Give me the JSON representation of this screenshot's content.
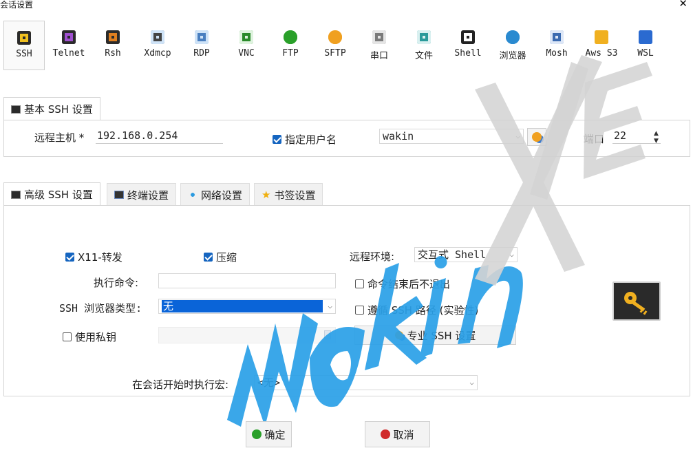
{
  "window": {
    "title": "会话设置",
    "close_glyph": "✕"
  },
  "protocols": [
    {
      "id": "ssh",
      "label": "SSH",
      "icon": "ssh-key-icon",
      "active": true,
      "color": "#f0c020",
      "bg": "#2b2b2b"
    },
    {
      "id": "telnet",
      "label": "Telnet",
      "icon": "telnet-icon",
      "color": "#a050d0",
      "bg": "#2b2b2b"
    },
    {
      "id": "rsh",
      "label": "Rsh",
      "icon": "rsh-icon",
      "color": "#e08020",
      "bg": "#2b2b2b"
    },
    {
      "id": "xdmcp",
      "label": "Xdmcp",
      "icon": "xdmcp-icon",
      "color": "#444",
      "bg": "#cfe3f7"
    },
    {
      "id": "rdp",
      "label": "RDP",
      "icon": "rdp-monitor-icon",
      "color": "#4a7fc0",
      "bg": "#cfe3f7"
    },
    {
      "id": "vnc",
      "label": "VNC",
      "icon": "vnc-icon",
      "color": "#2a8a2a",
      "bg": "#dff3df"
    },
    {
      "id": "ftp",
      "label": "FTP",
      "icon": "ftp-globe-icon",
      "color": "#2aa02a",
      "bg": "#2aa02a"
    },
    {
      "id": "sftp",
      "label": "SFTP",
      "icon": "sftp-globe-icon",
      "color": "#f0a020",
      "bg": "#f0a020"
    },
    {
      "id": "serial",
      "label": "串口",
      "icon": "serial-plug-icon",
      "color": "#7a7a7a",
      "bg": "#e5e5e5"
    },
    {
      "id": "file",
      "label": "文件",
      "icon": "file-monitor-icon",
      "color": "#2a9a9a",
      "bg": "#d9f0f0"
    },
    {
      "id": "shell",
      "label": "Shell",
      "icon": "shell-terminal-icon",
      "color": "#ffffff",
      "bg": "#222"
    },
    {
      "id": "browser",
      "label": "浏览器",
      "icon": "browser-globe-icon",
      "color": "#2a8ad0",
      "bg": "#2a8ad0"
    },
    {
      "id": "mosh",
      "label": "Mosh",
      "icon": "mosh-satellite-icon",
      "color": "#3a6ab0",
      "bg": "#dde7f7"
    },
    {
      "id": "awss3",
      "label": "Aws S3",
      "icon": "aws-s3-icon",
      "color": "#f0b020",
      "bg": "#f0b020"
    },
    {
      "id": "wsl",
      "label": "WSL",
      "icon": "wsl-windows-icon",
      "color": "#2a6ad0",
      "bg": "#2a6ad0"
    }
  ],
  "basic": {
    "tab_label": "基本 SSH 设置",
    "remote_host_label": "远程主机 *",
    "remote_host_value": "192.168.0.254",
    "specify_user_label": "指定用户名",
    "specify_user_checked": true,
    "username_value": "wakin",
    "port_label": "端口",
    "port_value": "22"
  },
  "advanced": {
    "tabs": [
      {
        "id": "adv-ssh",
        "label": "高级 SSH 设置",
        "active": true,
        "icon": "ssh-key-icon"
      },
      {
        "id": "terminal",
        "label": "终端设置",
        "icon": "terminal-icon"
      },
      {
        "id": "network",
        "label": "网络设置",
        "icon": "network-icon"
      },
      {
        "id": "bookmark",
        "label": "书签设置",
        "icon": "star-icon"
      }
    ],
    "x11_label": "X11-转发",
    "x11_checked": true,
    "compress_label": "压缩",
    "compress_checked": true,
    "remote_env_label": "远程环境:",
    "remote_env_value": "交互式 Shell",
    "exec_cmd_label": "执行命令:",
    "exec_cmd_value": "",
    "no_exit_label": "命令结束后不退出",
    "no_exit_checked": false,
    "browser_type_label": "SSH 浏览器类型:",
    "browser_type_value": "无",
    "follow_path_label": "遵循 SSH 路径 (实验性)",
    "follow_path_checked": false,
    "use_key_label": "使用私钥",
    "use_key_checked": false,
    "pro_ssh_label": "专业 SSH 设置",
    "macro_label": "在会话开始时执行宏:",
    "macro_value": "<无>"
  },
  "footer": {
    "ok_label": "确定",
    "cancel_label": "取消",
    "ok_color": "#2aa02a",
    "cancel_color": "#d02a2a"
  },
  "watermark": {
    "text": "Wakin XIE",
    "color_blue": "#2aa0e8"
  },
  "icons": {
    "dropdown_caret": "⌵",
    "spin_up": "▲",
    "spin_down": "▼"
  }
}
